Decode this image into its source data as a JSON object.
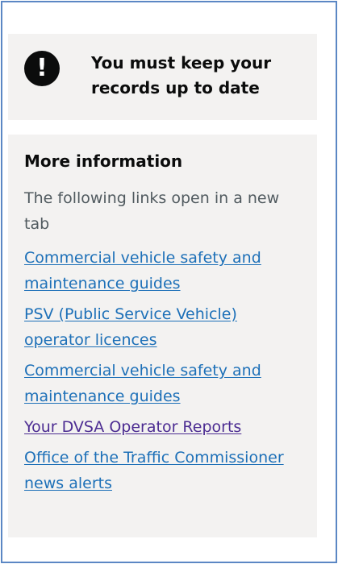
{
  "notice": {
    "icon_name": "exclamation-icon",
    "icon_glyph": "!",
    "text": "You must keep your records up to date"
  },
  "more_info": {
    "title": "More information",
    "description": "The following links open in a new tab",
    "links": [
      {
        "label": "Commercial vehicle safety and maintenance guides",
        "color": "#1d70b8"
      },
      {
        "label": "PSV (Public Service Vehicle) operator licences",
        "color": "#1d70b8"
      },
      {
        "label": "Commercial vehicle safety and maintenance guides",
        "color": "#1d70b8"
      },
      {
        "label": "Your DVSA Operator Reports",
        "color": "#4c2c92"
      },
      {
        "label": "Office of the Traffic Commissioner news alerts",
        "color": "#1d70b8"
      }
    ]
  },
  "colors": {
    "frame_border": "#5b87c4",
    "panel_background": "#f3f2f1",
    "link": "#1d70b8",
    "visited_link": "#4c2c92",
    "text": "#0b0c0c",
    "secondary_text": "#505a5f"
  }
}
